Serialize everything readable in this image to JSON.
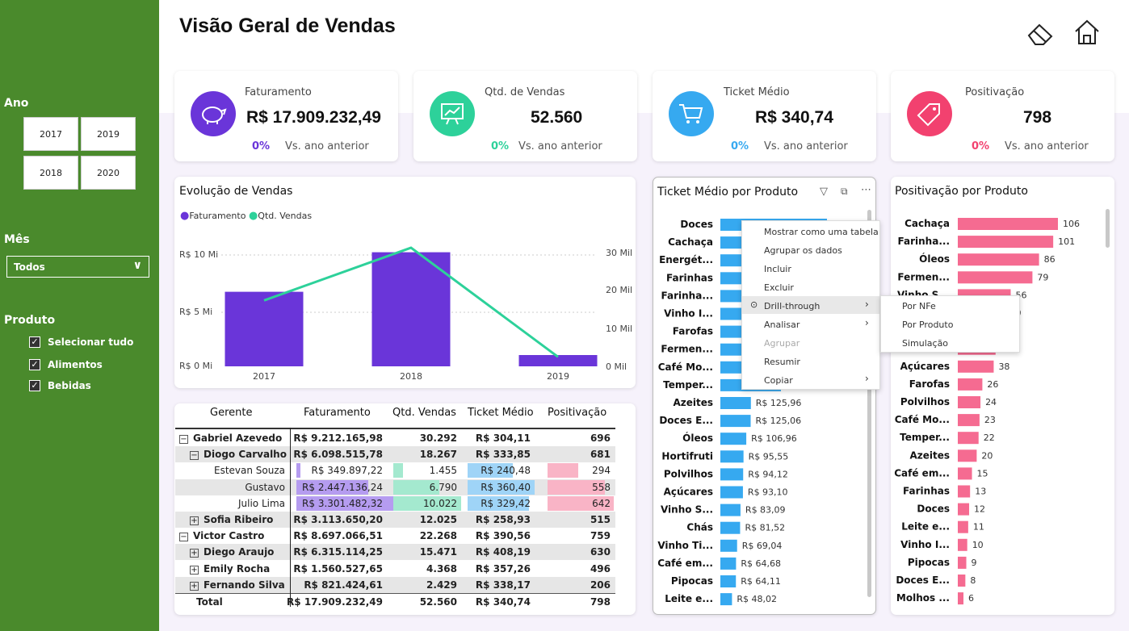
{
  "page_title": "Visão Geral de Vendas",
  "header_icons": [
    "eraser-icon",
    "home-icon"
  ],
  "sidebar": {
    "ano_label": "Ano",
    "years": [
      "2017",
      "2019",
      "2018",
      "2020"
    ],
    "mes_label": "Mês",
    "mes_value": "Todos",
    "produto_label": "Produto",
    "produto_options": [
      "Selecionar tudo",
      "Alimentos",
      "Bebidas"
    ]
  },
  "kpis": [
    {
      "label": "Faturamento",
      "value": "R$ 17.909.232,49",
      "pct": "0%",
      "vs": "Vs. ano anterior",
      "icon": "piggy-bank-icon",
      "color": "#6a35d9"
    },
    {
      "label": "Qtd. de Vendas",
      "value": "52.560",
      "pct": "0%",
      "vs": "Vs. ano anterior",
      "icon": "presentation-chart-icon",
      "color": "#2dd19a"
    },
    {
      "label": "Ticket Médio",
      "value": "R$ 340,74",
      "pct": "0%",
      "vs": "Vs. ano anterior",
      "icon": "shopping-cart-icon",
      "color": "#36a9f0"
    },
    {
      "label": "Positivação",
      "value": "798",
      "pct": "0%",
      "vs": "Vs. ano anterior",
      "icon": "tag-icon",
      "color": "#f2416f"
    }
  ],
  "evolucao": {
    "title": "Evolução de Vendas",
    "legend": [
      "Faturamento",
      "Qtd. Vendas"
    ],
    "colors": {
      "bar": "#6a35d9",
      "line": "#2dd19a"
    },
    "left_ticks": [
      "R$ 10 Mi",
      "R$ 5 Mi",
      "R$ 0 Mi"
    ],
    "right_ticks": [
      "30 Mil",
      "20 Mil",
      "10 Mil",
      "0 Mil"
    ]
  },
  "chart_data": [
    {
      "type": "bar",
      "title": "Evolução de Vendas",
      "categories": [
        "2017",
        "2018",
        "2019"
      ],
      "series": [
        {
          "name": "Faturamento",
          "type": "bar",
          "axis": "left",
          "values": [
            6.6,
            10.1,
            1.0
          ]
        },
        {
          "name": "Qtd. Vendas",
          "type": "line",
          "axis": "right",
          "values": [
            17.5,
            31.5,
            2.5
          ]
        }
      ],
      "ylim_left": [
        0,
        12.5
      ],
      "ylim_right": [
        0,
        37.5
      ]
    },
    {
      "type": "bar",
      "title": "Ticket Médio por Produto",
      "orientation": "horizontal",
      "categories": [
        "Doces",
        "Cachaça",
        "Energét...",
        "Farinhas",
        "Farinha...",
        "Vinho I...",
        "Farofas",
        "Fermen...",
        "Café Mo...",
        "Temper...",
        "Azeites",
        "Doces E...",
        "Óleos",
        "Hortifruti",
        "Polvilhos",
        "Açúcares",
        "Vinho S...",
        "Chás",
        "Vinho Ti...",
        "Café em...",
        "Pipocas",
        "Leite e..."
      ],
      "values": [
        440,
        430,
        420,
        410,
        400,
        380,
        360,
        350,
        300,
        250,
        125.96,
        125.06,
        106.96,
        95.55,
        94.12,
        93.1,
        83.09,
        81.52,
        69.04,
        64.68,
        64.11,
        48.02
      ],
      "labels": [
        "",
        "",
        "",
        "",
        "",
        "",
        "",
        "",
        "",
        "",
        "R$ 125,96",
        "R$ 125,06",
        "R$ 106,96",
        "R$ 95,55",
        "R$ 94,12",
        "R$ 93,10",
        "R$ 83,09",
        "R$ 81,52",
        "R$ 69,04",
        "R$ 64,68",
        "R$ 64,11",
        "R$ 48,02"
      ],
      "color": "#36a9f0"
    },
    {
      "type": "bar",
      "title": "Positivação por Produto",
      "orientation": "horizontal",
      "categories": [
        "Cachaça",
        "Farinha...",
        "Óleos",
        "Fermen...",
        "Vinho S...",
        "",
        "",
        "",
        "Açúcares",
        "Farofas",
        "Polvilhos",
        "Café Mo...",
        "Temper...",
        "Azeites",
        "Café em...",
        "Farinhas",
        "Doces",
        "Leite e...",
        "Vinho I...",
        "Pipocas",
        "Doces E...",
        "Molhos ..."
      ],
      "values": [
        106,
        101,
        86,
        79,
        56,
        50,
        45,
        40,
        38,
        26,
        24,
        23,
        22,
        20,
        15,
        13,
        12,
        11,
        10,
        9,
        8,
        6
      ],
      "color": "#f56b91"
    }
  ],
  "ticket_title": "Ticket Médio por Produto",
  "posit_title": "Positivação por Produto",
  "context_menu": {
    "items": [
      "Mostrar como uma tabela",
      "Agrupar os dados",
      "Incluir",
      "Excluir",
      "Drill-through",
      "Analisar",
      "Agrupar",
      "Resumir",
      "Copiar"
    ],
    "submenu": [
      "Por NFe",
      "Por Produto",
      "Simulação"
    ]
  },
  "matrix": {
    "headers": [
      "Gerente",
      "Faturamento",
      "Qtd. Vendas",
      "Ticket Médio",
      "Positivação"
    ],
    "rows": [
      {
        "name": "Gabriel Azevedo",
        "level": 0,
        "pm": "−",
        "fat": "R$ 9.212.165,98",
        "qtd": "30.292",
        "tm": "R$ 304,11",
        "pos": "696",
        "bold": true
      },
      {
        "name": "Diogo Carvalho",
        "level": 1,
        "pm": "−",
        "fat": "R$ 6.098.515,78",
        "qtd": "18.267",
        "tm": "R$ 333,85",
        "pos": "681",
        "bold": true
      },
      {
        "name": "Estevan Souza",
        "level": 2,
        "pm": "",
        "fat": "R$ 349.897,22",
        "qtd": "1.455",
        "tm": "R$ 240,48",
        "pos": "294",
        "bold": false,
        "bars": [
          0.04,
          0.14,
          0.67,
          0.46
        ]
      },
      {
        "name": "Gustavo",
        "level": 2,
        "pm": "",
        "fat": "R$ 2.447.136,24",
        "qtd": "6.790",
        "tm": "R$ 360,40",
        "pos": "558",
        "bold": false,
        "bars": [
          0.74,
          0.68,
          1.0,
          0.87
        ]
      },
      {
        "name": "Julio Lima",
        "level": 2,
        "pm": "",
        "fat": "R$ 3.301.482,32",
        "qtd": "10.022",
        "tm": "R$ 329,42",
        "pos": "642",
        "bold": false,
        "bars": [
          1.0,
          1.0,
          0.91,
          1.0
        ]
      },
      {
        "name": "Sofia Ribeiro",
        "level": 1,
        "pm": "+",
        "fat": "R$ 3.113.650,20",
        "qtd": "12.025",
        "tm": "R$ 258,93",
        "pos": "515",
        "bold": true
      },
      {
        "name": "Victor Castro",
        "level": 0,
        "pm": "−",
        "fat": "R$ 8.697.066,51",
        "qtd": "22.268",
        "tm": "R$ 390,56",
        "pos": "759",
        "bold": true
      },
      {
        "name": "Diego Araujo",
        "level": 1,
        "pm": "+",
        "fat": "R$ 6.315.114,25",
        "qtd": "15.471",
        "tm": "R$ 408,19",
        "pos": "630",
        "bold": true
      },
      {
        "name": "Emily Rocha",
        "level": 1,
        "pm": "+",
        "fat": "R$ 1.560.527,65",
        "qtd": "4.368",
        "tm": "R$ 357,26",
        "pos": "496",
        "bold": true
      },
      {
        "name": "Fernando Silva",
        "level": 1,
        "pm": "+",
        "fat": "R$ 821.424,61",
        "qtd": "2.429",
        "tm": "R$ 338,17",
        "pos": "206",
        "bold": true
      },
      {
        "name": "Total",
        "level": 0,
        "pm": "",
        "fat": "R$ 17.909.232,49",
        "qtd": "52.560",
        "tm": "R$ 340,74",
        "pos": "798",
        "bold": true
      }
    ]
  }
}
